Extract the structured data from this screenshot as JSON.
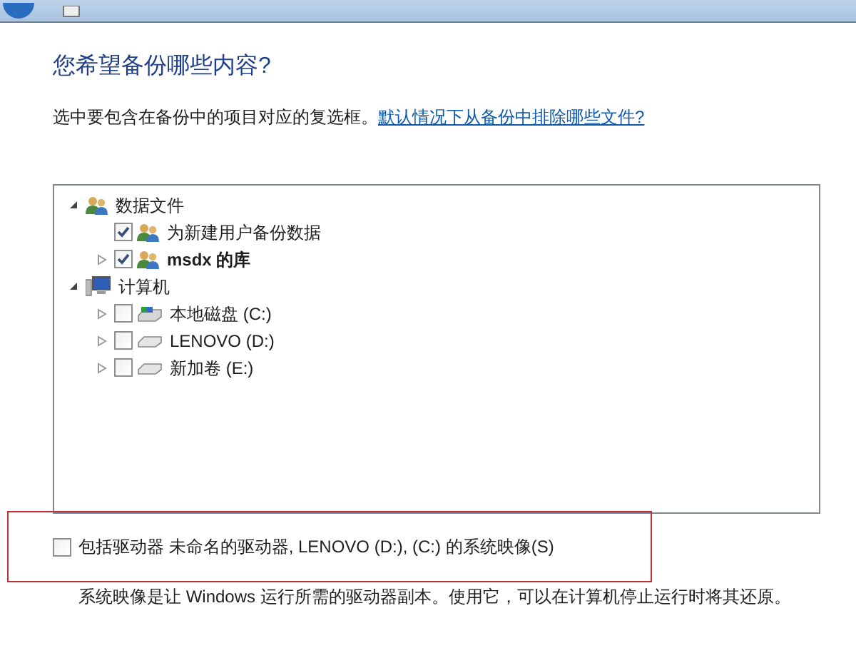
{
  "heading": "您希望备份哪些内容?",
  "instruction": {
    "text": "选中要包含在备份中的项目对应的复选框。",
    "link": "默认情况下从备份中排除哪些文件?"
  },
  "tree": [
    {
      "label": "数据文件",
      "kind": "users",
      "expanded": true,
      "bold": false,
      "children": [
        {
          "label": "为新建用户备份数据",
          "kind": "users",
          "checked": true,
          "bold": false
        },
        {
          "label": "msdx 的库",
          "kind": "users",
          "checked": true,
          "expanded": false,
          "bold": true
        }
      ]
    },
    {
      "label": "计算机",
      "kind": "computer",
      "expanded": true,
      "bold": false,
      "children": [
        {
          "label": "本地磁盘 (C:)",
          "kind": "system",
          "checked": false,
          "expanded": false,
          "bold": false
        },
        {
          "label": "LENOVO (D:)",
          "kind": "drive",
          "checked": false,
          "expanded": false,
          "bold": false
        },
        {
          "label": "新加卷 (E:)",
          "kind": "drive",
          "checked": false,
          "expanded": false,
          "bold": false
        }
      ]
    }
  ],
  "system_image": {
    "label": "包括驱动器 未命名的驱动器, LENOVO (D:), (C:) 的系统映像(S)",
    "checked": false,
    "note": "系统映像是让 Windows 运行所需的驱动器副本。使用它，可以在计算机停止运行时将其还原。"
  }
}
